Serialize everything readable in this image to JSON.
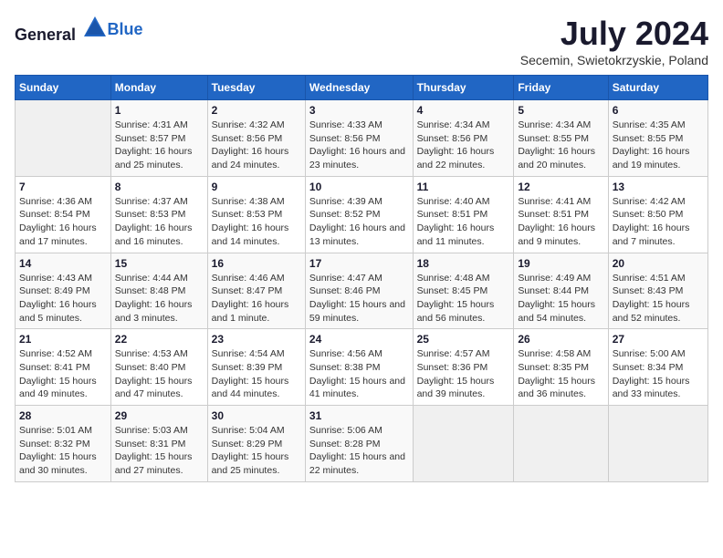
{
  "logo": {
    "text_general": "General",
    "text_blue": "Blue"
  },
  "title": {
    "month": "July 2024",
    "location": "Secemin, Swietokrzyskie, Poland"
  },
  "weekdays": [
    "Sunday",
    "Monday",
    "Tuesday",
    "Wednesday",
    "Thursday",
    "Friday",
    "Saturday"
  ],
  "weeks": [
    [
      {
        "day": "",
        "info": ""
      },
      {
        "day": "1",
        "info": "Sunrise: 4:31 AM\nSunset: 8:57 PM\nDaylight: 16 hours and 25 minutes."
      },
      {
        "day": "2",
        "info": "Sunrise: 4:32 AM\nSunset: 8:56 PM\nDaylight: 16 hours and 24 minutes."
      },
      {
        "day": "3",
        "info": "Sunrise: 4:33 AM\nSunset: 8:56 PM\nDaylight: 16 hours and 23 minutes."
      },
      {
        "day": "4",
        "info": "Sunrise: 4:34 AM\nSunset: 8:56 PM\nDaylight: 16 hours and 22 minutes."
      },
      {
        "day": "5",
        "info": "Sunrise: 4:34 AM\nSunset: 8:55 PM\nDaylight: 16 hours and 20 minutes."
      },
      {
        "day": "6",
        "info": "Sunrise: 4:35 AM\nSunset: 8:55 PM\nDaylight: 16 hours and 19 minutes."
      }
    ],
    [
      {
        "day": "7",
        "info": "Sunrise: 4:36 AM\nSunset: 8:54 PM\nDaylight: 16 hours and 17 minutes."
      },
      {
        "day": "8",
        "info": "Sunrise: 4:37 AM\nSunset: 8:53 PM\nDaylight: 16 hours and 16 minutes."
      },
      {
        "day": "9",
        "info": "Sunrise: 4:38 AM\nSunset: 8:53 PM\nDaylight: 16 hours and 14 minutes."
      },
      {
        "day": "10",
        "info": "Sunrise: 4:39 AM\nSunset: 8:52 PM\nDaylight: 16 hours and 13 minutes."
      },
      {
        "day": "11",
        "info": "Sunrise: 4:40 AM\nSunset: 8:51 PM\nDaylight: 16 hours and 11 minutes."
      },
      {
        "day": "12",
        "info": "Sunrise: 4:41 AM\nSunset: 8:51 PM\nDaylight: 16 hours and 9 minutes."
      },
      {
        "day": "13",
        "info": "Sunrise: 4:42 AM\nSunset: 8:50 PM\nDaylight: 16 hours and 7 minutes."
      }
    ],
    [
      {
        "day": "14",
        "info": "Sunrise: 4:43 AM\nSunset: 8:49 PM\nDaylight: 16 hours and 5 minutes."
      },
      {
        "day": "15",
        "info": "Sunrise: 4:44 AM\nSunset: 8:48 PM\nDaylight: 16 hours and 3 minutes."
      },
      {
        "day": "16",
        "info": "Sunrise: 4:46 AM\nSunset: 8:47 PM\nDaylight: 16 hours and 1 minute."
      },
      {
        "day": "17",
        "info": "Sunrise: 4:47 AM\nSunset: 8:46 PM\nDaylight: 15 hours and 59 minutes."
      },
      {
        "day": "18",
        "info": "Sunrise: 4:48 AM\nSunset: 8:45 PM\nDaylight: 15 hours and 56 minutes."
      },
      {
        "day": "19",
        "info": "Sunrise: 4:49 AM\nSunset: 8:44 PM\nDaylight: 15 hours and 54 minutes."
      },
      {
        "day": "20",
        "info": "Sunrise: 4:51 AM\nSunset: 8:43 PM\nDaylight: 15 hours and 52 minutes."
      }
    ],
    [
      {
        "day": "21",
        "info": "Sunrise: 4:52 AM\nSunset: 8:41 PM\nDaylight: 15 hours and 49 minutes."
      },
      {
        "day": "22",
        "info": "Sunrise: 4:53 AM\nSunset: 8:40 PM\nDaylight: 15 hours and 47 minutes."
      },
      {
        "day": "23",
        "info": "Sunrise: 4:54 AM\nSunset: 8:39 PM\nDaylight: 15 hours and 44 minutes."
      },
      {
        "day": "24",
        "info": "Sunrise: 4:56 AM\nSunset: 8:38 PM\nDaylight: 15 hours and 41 minutes."
      },
      {
        "day": "25",
        "info": "Sunrise: 4:57 AM\nSunset: 8:36 PM\nDaylight: 15 hours and 39 minutes."
      },
      {
        "day": "26",
        "info": "Sunrise: 4:58 AM\nSunset: 8:35 PM\nDaylight: 15 hours and 36 minutes."
      },
      {
        "day": "27",
        "info": "Sunrise: 5:00 AM\nSunset: 8:34 PM\nDaylight: 15 hours and 33 minutes."
      }
    ],
    [
      {
        "day": "28",
        "info": "Sunrise: 5:01 AM\nSunset: 8:32 PM\nDaylight: 15 hours and 30 minutes."
      },
      {
        "day": "29",
        "info": "Sunrise: 5:03 AM\nSunset: 8:31 PM\nDaylight: 15 hours and 27 minutes."
      },
      {
        "day": "30",
        "info": "Sunrise: 5:04 AM\nSunset: 8:29 PM\nDaylight: 15 hours and 25 minutes."
      },
      {
        "day": "31",
        "info": "Sunrise: 5:06 AM\nSunset: 8:28 PM\nDaylight: 15 hours and 22 minutes."
      },
      {
        "day": "",
        "info": ""
      },
      {
        "day": "",
        "info": ""
      },
      {
        "day": "",
        "info": ""
      }
    ]
  ]
}
